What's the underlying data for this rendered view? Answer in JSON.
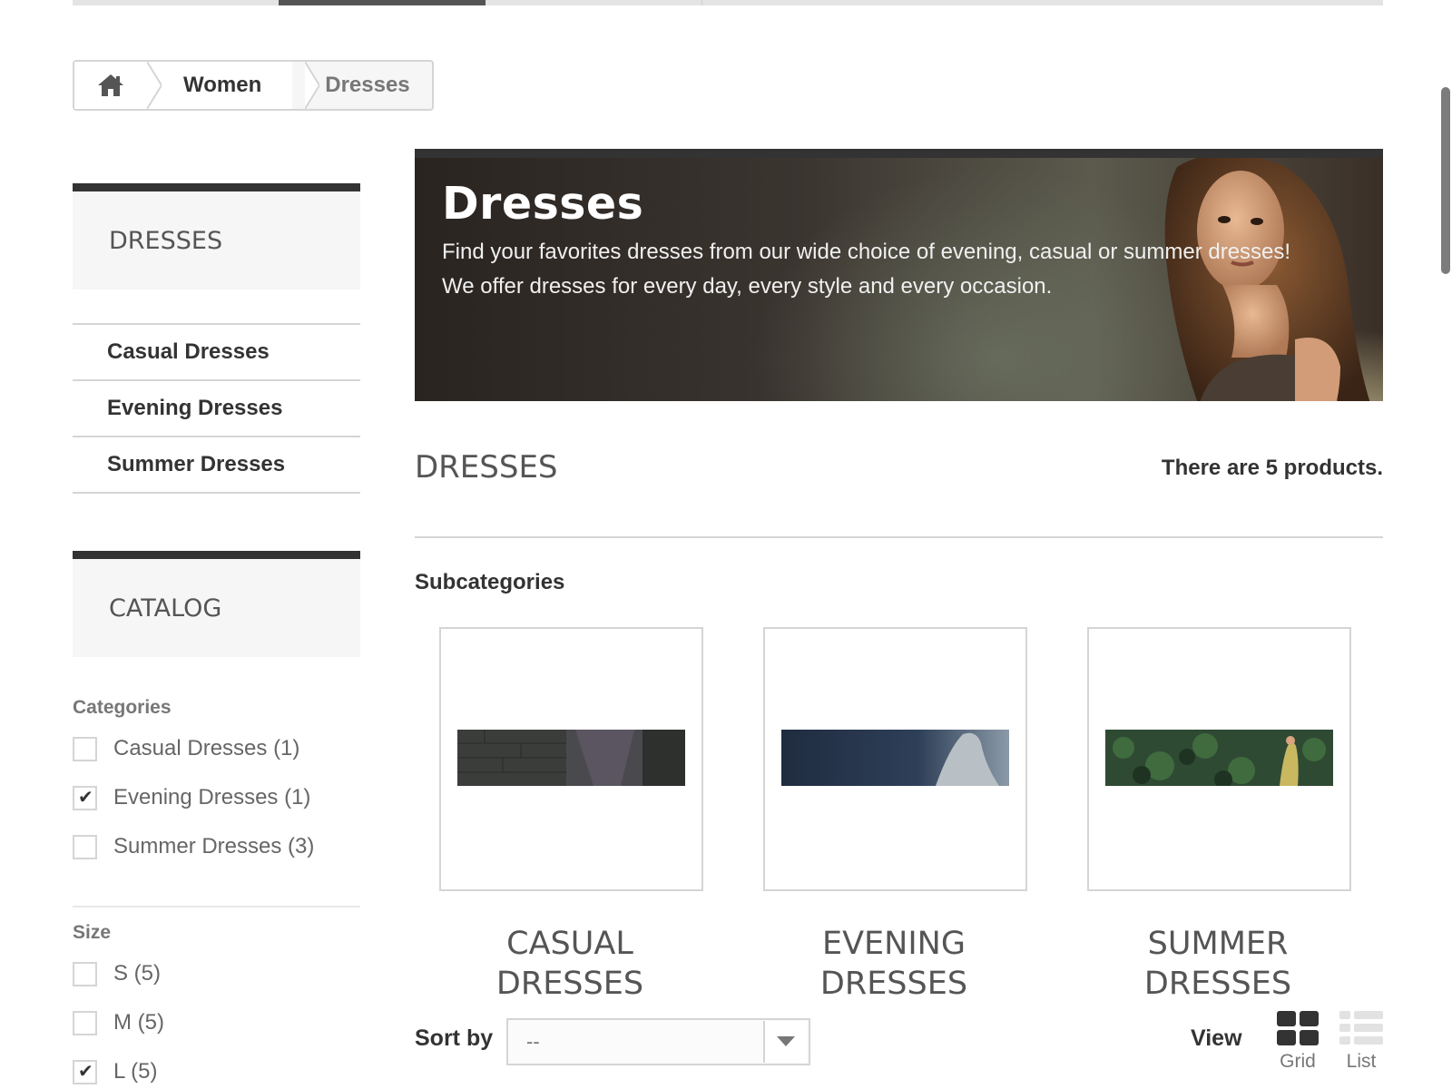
{
  "breadcrumb": {
    "home_icon": "home-icon",
    "items": [
      "Women",
      "Dresses"
    ]
  },
  "sidebar": {
    "block_title": "DRESSES",
    "subcategories": [
      "Casual Dresses",
      "Evening Dresses",
      "Summer Dresses"
    ],
    "catalog_title": "CATALOG",
    "filters": {
      "categories": {
        "title": "Categories",
        "options": [
          {
            "label": "Casual Dresses (1)",
            "checked": false
          },
          {
            "label": "Evening Dresses (1)",
            "checked": true
          },
          {
            "label": "Summer Dresses (3)",
            "checked": false
          }
        ]
      },
      "size": {
        "title": "Size",
        "options": [
          {
            "label": "S (5)",
            "checked": false
          },
          {
            "label": "M (5)",
            "checked": false
          },
          {
            "label": "L (5)",
            "checked": true
          }
        ]
      }
    }
  },
  "banner": {
    "title": "Dresses",
    "line1": "Find your favorites dresses from our wide choice of evening, casual or summer dresses!",
    "line2": "We offer dresses for every day, every style and every occasion."
  },
  "main": {
    "heading": "DRESSES",
    "product_count": "There are 5 products.",
    "subcategories_title": "Subcategories",
    "subcategories": [
      {
        "line1": "CASUAL",
        "line2": "DRESSES"
      },
      {
        "line1": "EVENING",
        "line2": "DRESSES"
      },
      {
        "line1": "SUMMER",
        "line2": "DRESSES"
      }
    ]
  },
  "toolbar": {
    "sort_label": "Sort by",
    "sort_value": "--",
    "view_label": "View",
    "grid_label": "Grid",
    "list_label": "List"
  },
  "colors": {
    "accent_dark": "#333333",
    "border": "#d6d4d4",
    "box_bg": "#f6f6f6"
  }
}
